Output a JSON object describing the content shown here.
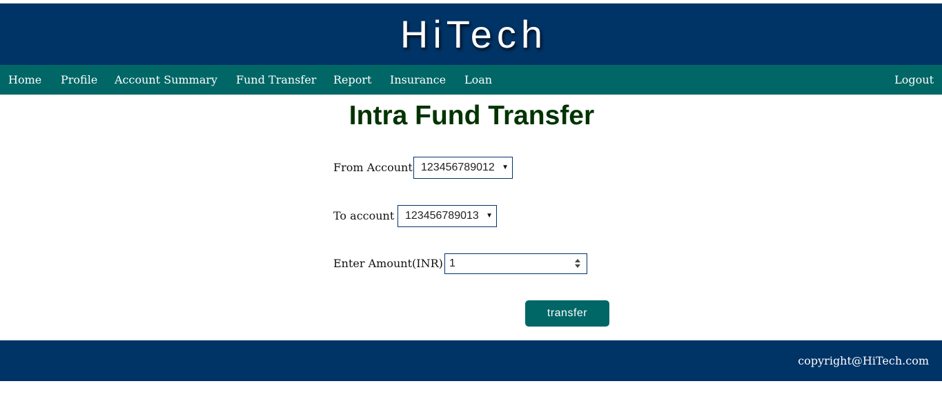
{
  "header": {
    "brand": "HiTech"
  },
  "nav": {
    "home": "Home",
    "profile": "Profile",
    "account_summary": "Account Summary",
    "fund_transfer": "Fund Transfer",
    "report": "Report",
    "insurance": "Insurance",
    "loan": "Loan",
    "logout": "Logout"
  },
  "page": {
    "title": "Intra Fund Transfer"
  },
  "form": {
    "from_label": "From Account",
    "from_value": "123456789012",
    "to_label": "To account",
    "to_value": "123456789013",
    "amount_label": "Enter Amount(INR)",
    "amount_value": "1",
    "submit_label": "transfer"
  },
  "footer": {
    "copyright": "copyright@HiTech.com"
  },
  "colors": {
    "header_bg": "#003366",
    "nav_bg": "#006666",
    "title_color": "#003300",
    "button_bg": "#006666"
  }
}
